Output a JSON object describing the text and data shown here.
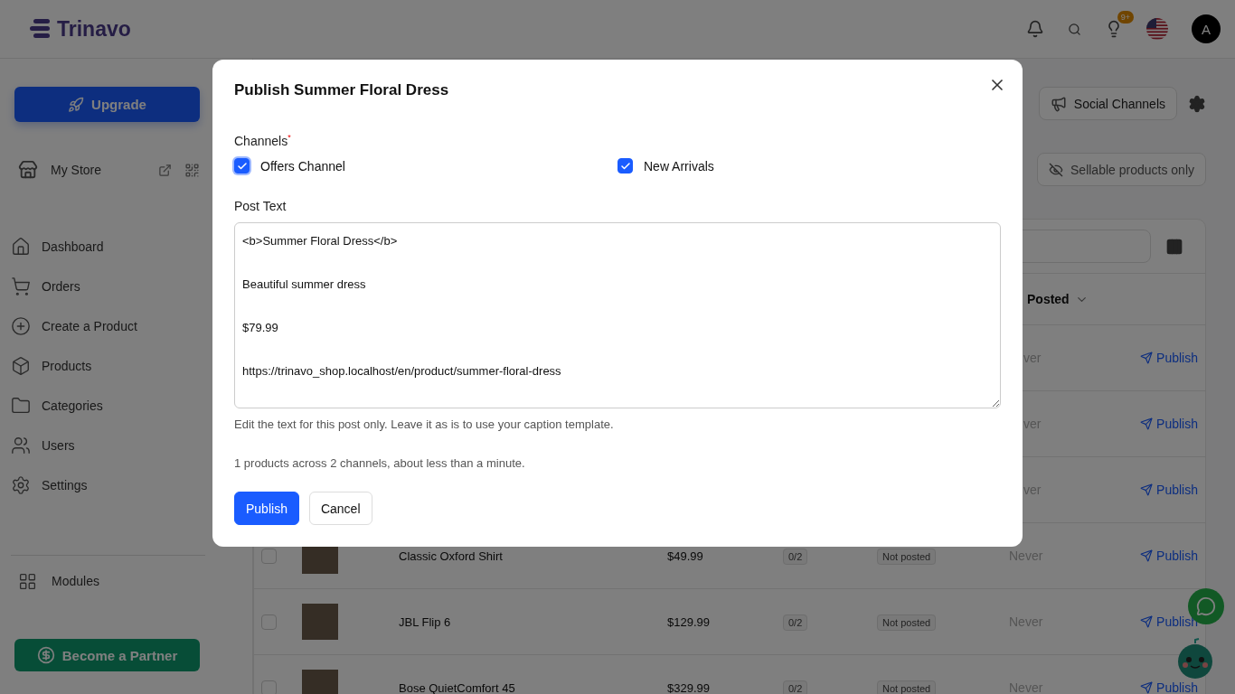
{
  "header": {
    "logo": "Trinavo",
    "notification_badge": "9+",
    "avatar_initial": "A"
  },
  "sidebar": {
    "upgrade": "Upgrade",
    "store": "My Store",
    "items": [
      "Dashboard",
      "Orders",
      "Create a Product",
      "Products",
      "Categories",
      "Users",
      "Settings"
    ],
    "modules": "Modules",
    "partner": "Become a Partner"
  },
  "toolbar": {
    "social_channels": "Social Channels",
    "sellable_filter": "Sellable products only"
  },
  "table": {
    "partial_column": "Posted",
    "rows": [
      {
        "last_posted_partial": "ver",
        "action": "Publish"
      },
      {
        "last_posted_partial": "ver",
        "action": "Publish"
      },
      {
        "last_posted_partial": "ver",
        "action": "Publish"
      },
      {
        "checked": false,
        "name": "Classic Oxford Shirt",
        "price": "$49.99",
        "count": "0/2",
        "status": "Not posted",
        "last_posted": "Never",
        "action": "Publish"
      },
      {
        "checked": false,
        "name": "JBL Flip 6",
        "price": "$129.99",
        "count": "0/2",
        "status": "Not posted",
        "last_posted": "Never",
        "action": "Publish"
      },
      {
        "checked": false,
        "name": "Bose QuietComfort 45",
        "price": "$329.99",
        "count": "0/2",
        "status": "Not posted",
        "last_posted": "Never",
        "action": "Publish"
      }
    ]
  },
  "dialog": {
    "title": "Publish Summer Floral Dress",
    "channels_label": "Channels",
    "required_mark": "*",
    "channels": [
      {
        "label": "Offers Channel",
        "checked": true,
        "focused": true
      },
      {
        "label": "New Arrivals",
        "checked": true,
        "focused": false
      }
    ],
    "post_text_label": "Post Text",
    "post_text": "<b>Summer Floral Dress</b>\n\nBeautiful summer dress\n\n$79.99\n\nhttps://trinavo_shop.localhost/en/product/summer-floral-dress",
    "help": "Edit the text for this post only. Leave it as is to use your caption template.",
    "summary": "1 products across 2 channels, about less than a minute.",
    "buttons": [
      {
        "label": "Publish",
        "kind": "primary"
      },
      {
        "label": "Cancel",
        "kind": "secondary"
      }
    ]
  }
}
